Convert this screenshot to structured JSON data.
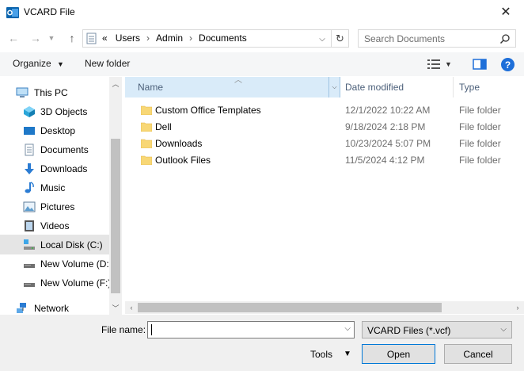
{
  "window": {
    "title": "VCARD File"
  },
  "address_bar": {
    "path": [
      "«",
      "Users",
      "Admin",
      "Documents"
    ]
  },
  "search": {
    "placeholder": "Search Documents"
  },
  "toolbar": {
    "organize_label": "Organize",
    "new_folder_label": "New folder"
  },
  "nav_pane": {
    "items": [
      {
        "label": "This PC",
        "icon": "computer-icon",
        "state": "normal"
      },
      {
        "label": "3D Objects",
        "icon": "3d-objects-icon",
        "state": "normal"
      },
      {
        "label": "Desktop",
        "icon": "desktop-icon",
        "state": "normal"
      },
      {
        "label": "Documents",
        "icon": "documents-icon",
        "state": "normal"
      },
      {
        "label": "Downloads",
        "icon": "download-arrow-icon",
        "state": "normal"
      },
      {
        "label": "Music",
        "icon": "music-note-icon",
        "state": "normal"
      },
      {
        "label": "Pictures",
        "icon": "pictures-icon",
        "state": "normal"
      },
      {
        "label": "Videos",
        "icon": "videos-icon",
        "state": "normal"
      },
      {
        "label": "Local Disk (C:)",
        "icon": "drive-icon",
        "state": "hover"
      },
      {
        "label": "New Volume (D:",
        "icon": "drive-icon",
        "state": "normal"
      },
      {
        "label": "New Volume (F:)",
        "icon": "drive-icon",
        "state": "normal"
      },
      {
        "label": "Network",
        "icon": "network-icon",
        "state": "normal"
      }
    ]
  },
  "file_list": {
    "columns": {
      "name": "Name",
      "date": "Date modified",
      "type": "Type"
    },
    "rows": [
      {
        "name": "Custom Office Templates",
        "date": "12/1/2022 10:22 AM",
        "type": "File folder"
      },
      {
        "name": "Dell",
        "date": "9/18/2024 2:18 PM",
        "type": "File folder"
      },
      {
        "name": "Downloads",
        "date": "10/23/2024 5:07 PM",
        "type": "File folder"
      },
      {
        "name": "Outlook Files",
        "date": "11/5/2024 4:12 PM",
        "type": "File folder"
      }
    ]
  },
  "bottom": {
    "file_name_label": "File name:",
    "file_name_value": "",
    "file_type_value": "VCARD Files (*.vcf)",
    "tools_label": "Tools",
    "open_label": "Open",
    "cancel_label": "Cancel"
  },
  "colors": {
    "accent": "#0078d7",
    "folder": "#f8d775",
    "help": "#1e6fd9",
    "header_selected": "#d9ebf9"
  }
}
